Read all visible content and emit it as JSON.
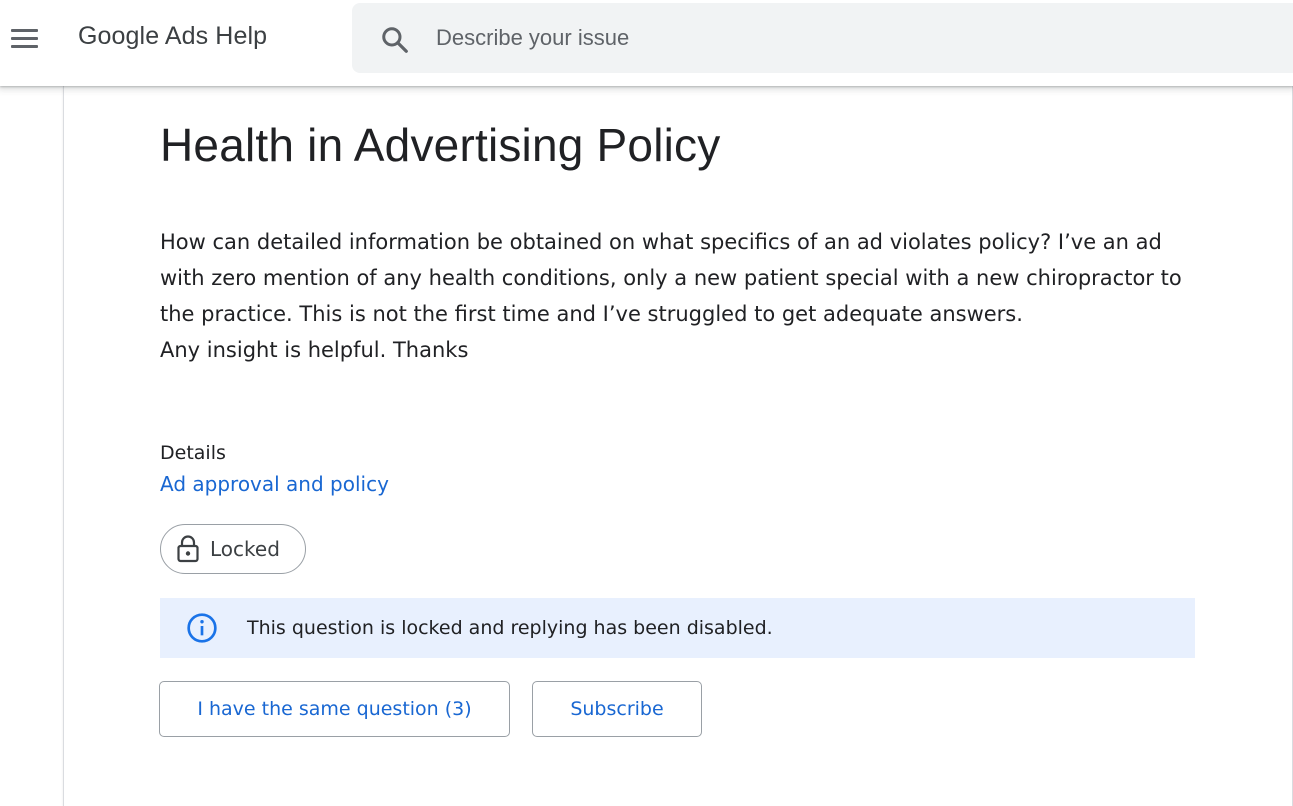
{
  "header": {
    "brand": "Google Ads Help",
    "search": {
      "placeholder": "Describe your issue",
      "value": ""
    }
  },
  "question": {
    "title": "Health in Advertising Policy",
    "body": [
      "How can detailed information be obtained on what specifics of an ad violates policy? I’ve an ad with zero mention of any health conditions, only a new patient special with a new chiropractor to the practice. This is not the first time and I’ve struggled to get adequate answers.",
      "Any insight is helpful. Thanks"
    ],
    "details_label": "Details",
    "details_link": "Ad approval and policy",
    "status_chip": "Locked",
    "notice": "This question is locked and replying has been disabled.",
    "actions": {
      "same_question": "I have the same question (3)",
      "subscribe": "Subscribe"
    }
  },
  "icons": [
    "menu-icon",
    "search-icon",
    "lock-icon",
    "info-icon"
  ],
  "colors": {
    "link": "#1967d2",
    "notice_bg": "#e8f0fe",
    "info_icon": "#1a73e8",
    "search_bg": "#f1f3f4"
  }
}
